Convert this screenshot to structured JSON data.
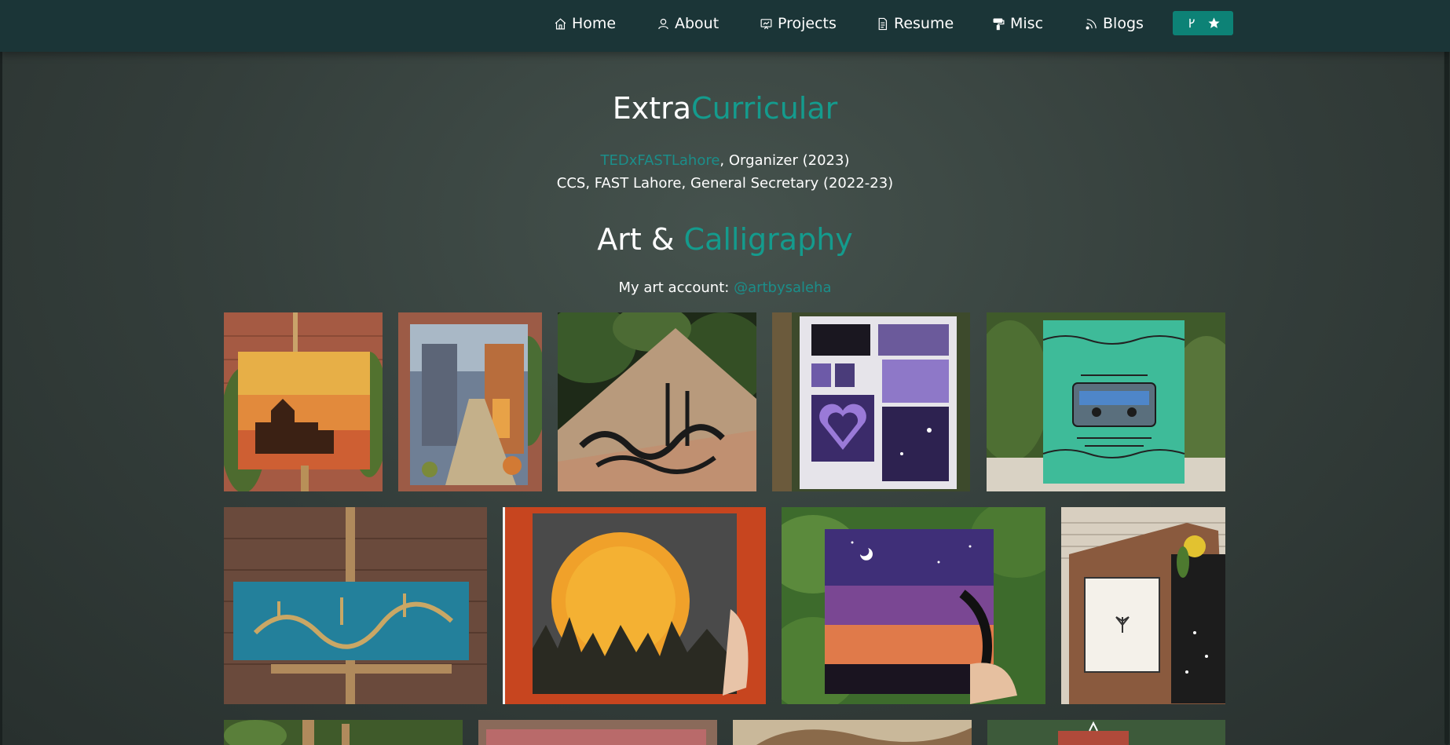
{
  "nav": {
    "items": [
      {
        "label": "Home",
        "icon": "home-icon"
      },
      {
        "label": "About",
        "icon": "user-icon"
      },
      {
        "label": "Projects",
        "icon": "projects-icon"
      },
      {
        "label": "Resume",
        "icon": "document-icon"
      },
      {
        "label": "Misc",
        "icon": "paint-roller-icon"
      },
      {
        "label": "Blogs",
        "icon": "rss-icon"
      }
    ],
    "github_icon": "fork-icon",
    "star_icon": "star-icon"
  },
  "extracurricular": {
    "title_plain": "Extra",
    "title_accent": "Curricular",
    "line1_link": "TEDxFASTLahore",
    "line1_rest": ", Organizer (2023)",
    "line2": "CCS, FAST Lahore, General Secretary (2022-23)"
  },
  "art": {
    "title_plain": "Art & ",
    "title_accent": "Calligraphy",
    "account_label": "My art account: ",
    "account_handle": "@artbysaleha"
  },
  "gallery": [
    {
      "name": "painting-mughal-fort"
    },
    {
      "name": "painting-alley-street"
    },
    {
      "name": "calligraphy-diamond-canvas"
    },
    {
      "name": "painting-ukiyo-evolve"
    },
    {
      "name": "painting-cassette-tape"
    },
    {
      "name": "calligraphy-blue-canvas"
    },
    {
      "name": "painting-full-moon"
    },
    {
      "name": "painting-purple-sunset"
    },
    {
      "name": "journal-collage"
    },
    {
      "name": "painting-bottom-1"
    },
    {
      "name": "painting-bottom-2"
    },
    {
      "name": "painting-bottom-3"
    },
    {
      "name": "painting-bottom-4"
    }
  ],
  "colors": {
    "navbar": "#1b3537",
    "accent": "#149b8d",
    "link": "#1b8e8a",
    "button": "#0d8276"
  }
}
